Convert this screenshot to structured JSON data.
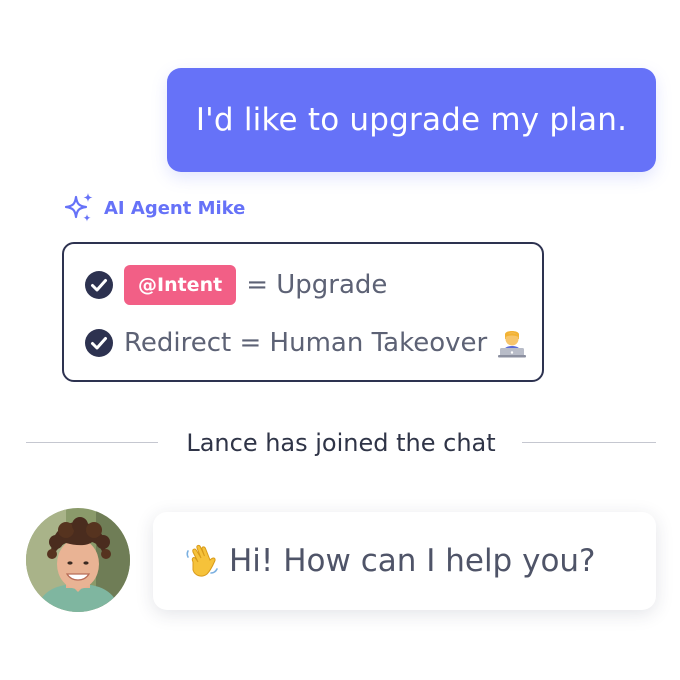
{
  "user_message": {
    "text": "I'd like to upgrade my plan."
  },
  "agent": {
    "name": "AI Agent Mike",
    "icon": "sparkles-icon"
  },
  "intent_card": {
    "rows": [
      {
        "icon": "check-circle-icon",
        "tag": "@Intent",
        "text": "= Upgrade"
      },
      {
        "icon": "check-circle-icon",
        "text": "Redirect = Human Takeover",
        "emoji": "technologist-emoji"
      }
    ]
  },
  "divider": {
    "text": "Lance has joined the chat"
  },
  "human_reply": {
    "emoji": "waving-hand-emoji",
    "text": "Hi! How can I help you?"
  },
  "colors": {
    "accent": "#6672f8",
    "tag": "#f25f86",
    "dark": "#2d3250"
  }
}
